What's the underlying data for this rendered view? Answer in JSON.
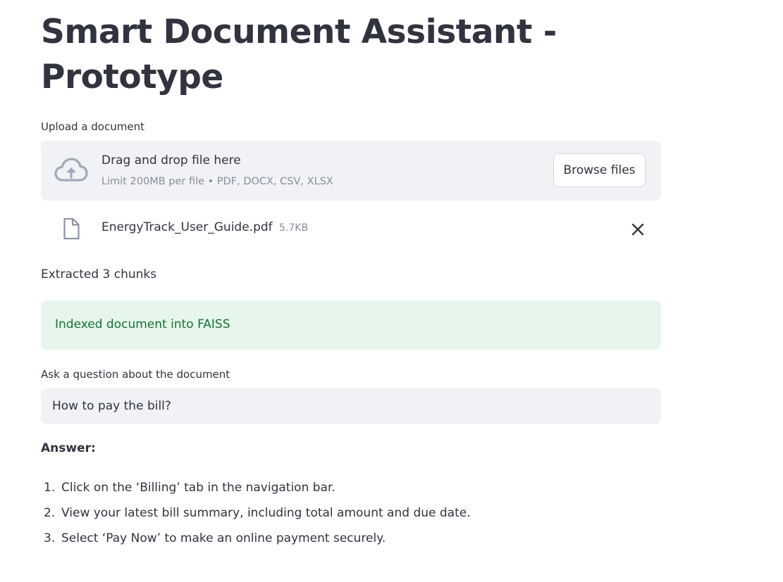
{
  "page": {
    "title": "Smart Document Assistant - Prototype"
  },
  "uploader": {
    "label": "Upload a document",
    "drag_text": "Drag and drop file here",
    "limit_text": "Limit 200MB per file • PDF, DOCX, CSV, XLSX",
    "browse_label": "Browse files",
    "icon": "cloud-upload-icon"
  },
  "uploaded_file": {
    "name": "EnergyTrack_User_Guide.pdf",
    "size": "5.7KB",
    "icon": "file-icon",
    "remove_icon": "close-icon"
  },
  "status": {
    "chunks_text": "Extracted 3 chunks",
    "success_text": "Indexed document into FAISS"
  },
  "question": {
    "label": "Ask a question about the document",
    "value": "How to pay the bill?"
  },
  "answer": {
    "heading": "Answer:",
    "steps": [
      {
        "num": "1.",
        "text": "Click on the ‘Billing’ tab in the navigation bar."
      },
      {
        "num": "2.",
        "text": "View your latest bill summary, including total amount and due date."
      },
      {
        "num": "3.",
        "text": "Select ‘Pay Now’ to make an online payment securely."
      }
    ]
  },
  "colors": {
    "text": "#31333f",
    "muted": "#8a8d97",
    "panel_bg": "#f0f2f6",
    "success_bg": "#e6f6ec",
    "success_text": "#177233"
  }
}
